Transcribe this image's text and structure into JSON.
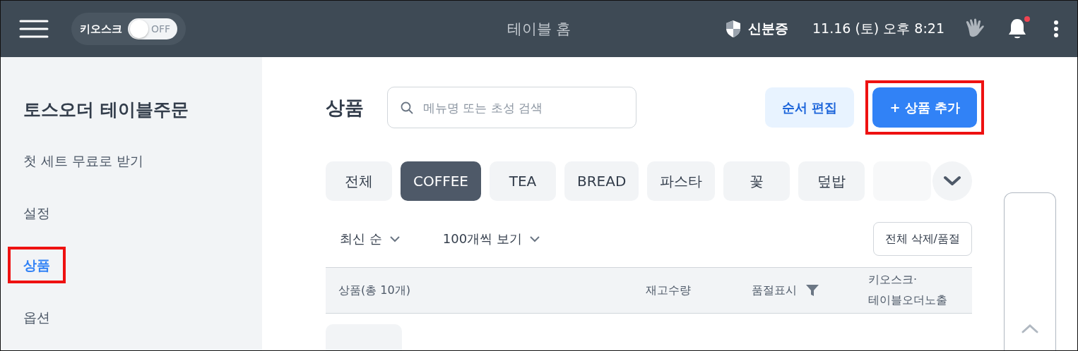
{
  "topbar": {
    "kiosk": {
      "label": "키오스크",
      "on": false,
      "state_text": "OFF"
    },
    "title": "테이블 홈",
    "id_label": "신분증",
    "datetime": "11.16 (토) 오후 8:21",
    "notification_dot": true
  },
  "sidebar": {
    "title": "토스오더 테이블주문",
    "items": [
      {
        "label": "첫 세트 무료로 받기",
        "selected": false,
        "highlighted": false
      },
      {
        "label": "설정",
        "selected": false,
        "highlighted": false
      },
      {
        "label": "상품",
        "selected": true,
        "highlighted": true
      },
      {
        "label": "옵션",
        "selected": false,
        "highlighted": false
      }
    ]
  },
  "header": {
    "title": "상품",
    "search": {
      "placeholder": "메뉴명 또는 초성 검색"
    },
    "buttons": [
      {
        "kind": "secondary",
        "label": "순서 편집",
        "highlighted": false
      },
      {
        "kind": "primary",
        "label": "+ 상품 추가",
        "highlighted": true
      }
    ]
  },
  "categories": [
    {
      "label": "전체",
      "selected": false
    },
    {
      "label": "COFFEE",
      "selected": true
    },
    {
      "label": "TEA",
      "selected": false
    },
    {
      "label": "BREAD",
      "selected": false
    },
    {
      "label": "파스타",
      "selected": false
    },
    {
      "label": "꽃",
      "selected": false
    },
    {
      "label": "덮밥",
      "selected": false
    }
  ],
  "filters": [
    {
      "label": "최신 순"
    },
    {
      "label": "100개씩 보기"
    }
  ],
  "bulk_button": "전체 삭제/품절",
  "table": {
    "columns": [
      {
        "kind": "text",
        "label": "상품(총 10개)"
      },
      {
        "kind": "text",
        "label": "재고수량"
      },
      {
        "kind": "filter",
        "label": "품절표시"
      },
      {
        "kind": "multiline",
        "lines": [
          "키오스크·",
          "테이블오더노출"
        ]
      }
    ]
  }
}
